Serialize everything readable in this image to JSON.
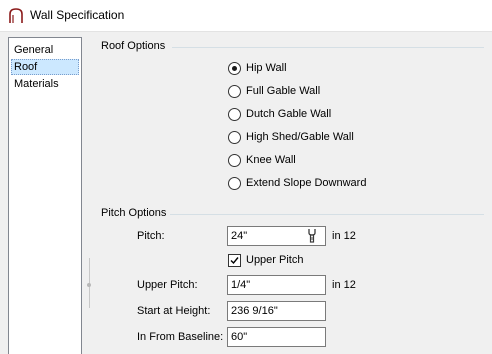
{
  "window": {
    "title": "Wall Specification"
  },
  "sidebar": {
    "items": [
      {
        "label": "General",
        "selected": false
      },
      {
        "label": "Roof",
        "selected": true
      },
      {
        "label": "Materials",
        "selected": false
      }
    ],
    "selected_bg": "#cce8ff"
  },
  "roof_options": {
    "title": "Roof Options",
    "options": [
      {
        "label": "Hip Wall",
        "checked": true
      },
      {
        "label": "Full Gable Wall",
        "checked": false
      },
      {
        "label": "Dutch Gable Wall",
        "checked": false
      },
      {
        "label": "High Shed/Gable Wall",
        "checked": false
      },
      {
        "label": "Knee Wall",
        "checked": false
      },
      {
        "label": "Extend Slope Downward",
        "checked": false
      }
    ]
  },
  "pitch_options": {
    "title": "Pitch Options",
    "pitch": {
      "label": "Pitch:",
      "value": "24\"",
      "unit": "in 12",
      "icon": "pitch-wrench-icon"
    },
    "upper_pitch_checkbox": {
      "label": "Upper Pitch",
      "checked": true
    },
    "upper_pitch": {
      "label": "Upper Pitch:",
      "value": "1/4\"",
      "unit": "in 12"
    },
    "start_at_height": {
      "label": "Start at Height:",
      "value": "236 9/16\""
    },
    "in_from_baseline": {
      "label": "In From Baseline:",
      "value": "60\""
    }
  }
}
